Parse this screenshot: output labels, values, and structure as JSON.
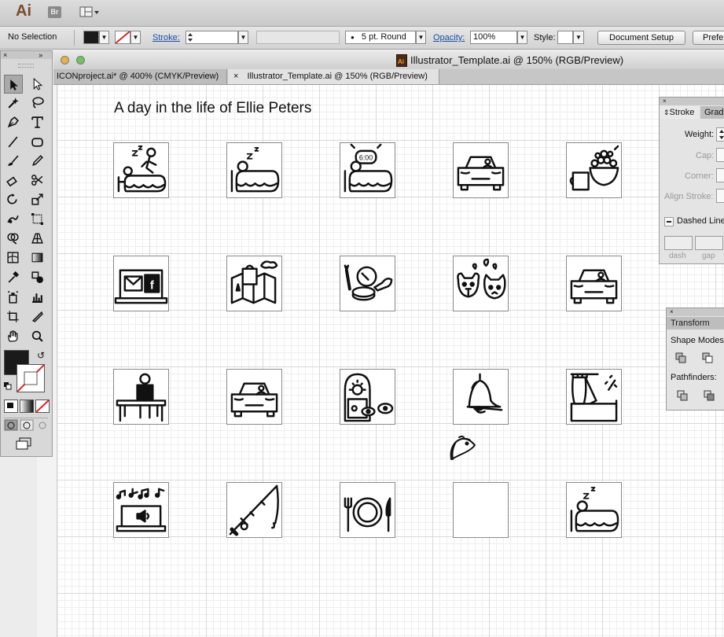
{
  "app": {
    "logo": "Ai",
    "bridge": "Br"
  },
  "control_bar": {
    "selection": "No Selection",
    "stroke_label": "Stroke:",
    "brush": "5 pt. Round",
    "opacity_label": "Opacity:",
    "opacity_value": "100%",
    "style_label": "Style:",
    "document_setup": "Document Setup",
    "preferences": "Prefer"
  },
  "window": {
    "title": "Illustrator_Template.ai @ 150% (RGB/Preview)"
  },
  "tabs": [
    {
      "label": "ICONproject.ai* @ 400% (CMYK/Preview)"
    },
    {
      "close": "×",
      "label": "Illustrator_Template.ai @ 150% (RGB/Preview)"
    }
  ],
  "document": {
    "title": "A day in the life of Ellie Peters",
    "icons": [
      [
        "sleeping-person-with-pet",
        "sleeping-person",
        "alarm-clock-6am",
        "car-front",
        "breakfast-mug-fruit-bowl"
      ],
      [
        "laptop-email-facebook",
        "map-and-shopping-bag",
        "makeup-compact-brush",
        "cat-and-dog-with-hearts",
        "car-front"
      ],
      [
        "person-at-desk-laptop",
        "car-front",
        "salon-hair-dryer",
        "bell",
        "shower-curtain-tub"
      ],
      [
        "laptop-music-notes",
        "fishing-rod",
        "fork-plate-knife",
        "empty",
        "sleeping-person"
      ]
    ],
    "alarm_text": "6:00",
    "stray_icon": "taco"
  },
  "stroke_panel": {
    "tab_stroke": "Stroke",
    "tab_gradient": "Grad",
    "weight_label": "Weight:",
    "cap_label": "Cap:",
    "corner_label": "Corner:",
    "align_label": "Align Stroke:",
    "dashed_label": "Dashed Line",
    "dash": "dash",
    "gap": "gap"
  },
  "pathfinder_panel": {
    "tab": "Transform",
    "shape_modes": "Shape Modes:",
    "pathfinders": "Pathfinders:"
  },
  "colors": {
    "fill": "#1a1a1a",
    "stroke_none": "#e02020",
    "accent_link": "#1a4fa3"
  }
}
